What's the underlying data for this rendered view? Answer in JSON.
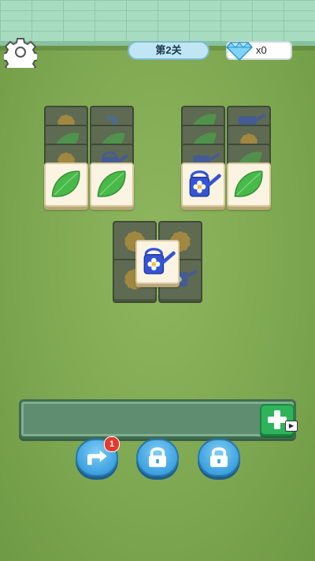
{
  "hud": {
    "level_label": "第2关",
    "gems_count": "x0"
  },
  "colors": {
    "background_green": "#7ea851",
    "tray_green": "#5e8e6f",
    "button_blue": "#3ea2e0",
    "add_green": "#2fb35a"
  },
  "tile_icons": [
    "leaf",
    "flower",
    "watering-can",
    "number-2"
  ],
  "buttons": {
    "undo_badge": "1",
    "add_video_icon": "▶"
  }
}
